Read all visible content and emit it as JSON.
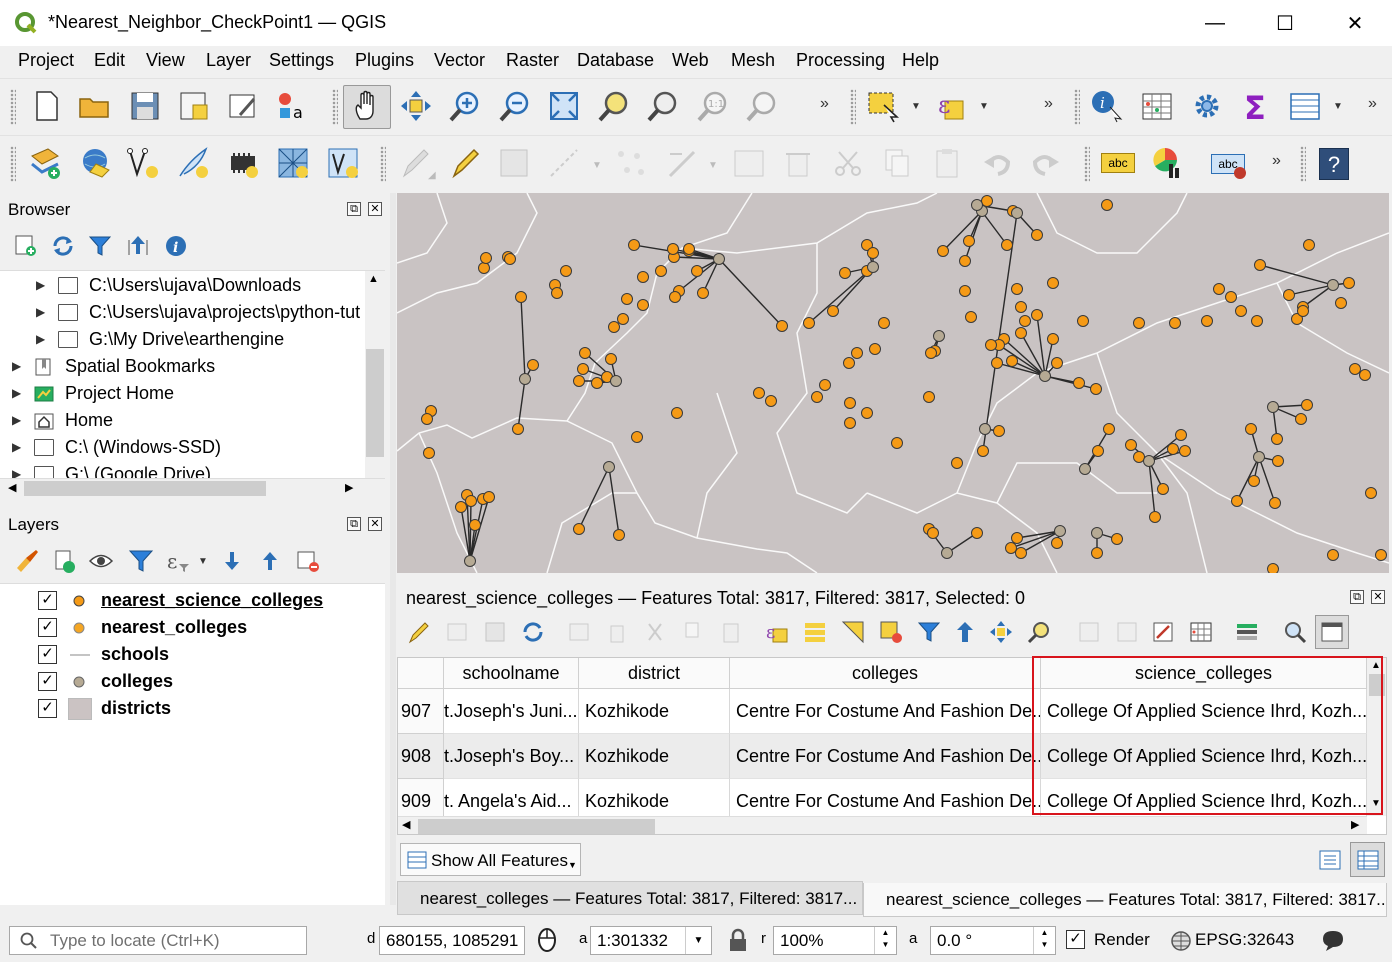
{
  "window": {
    "title": "*Nearest_Neighbor_CheckPoint1 — QGIS",
    "minimize": "—",
    "maximize": "☐",
    "close": "✕"
  },
  "menubar": {
    "items": [
      "Project",
      "Edit",
      "View",
      "Layer",
      "Settings",
      "Plugins",
      "Vector",
      "Raster",
      "Database",
      "Web",
      "Mesh",
      "Processing",
      "Help"
    ]
  },
  "toolbar1": {
    "icons": [
      "new-project-icon",
      "open-project-icon",
      "save-project-icon",
      "new-print-layout-icon",
      "layout-manager-icon",
      "style-manager-icon",
      "pan-hand-icon",
      "pan-to-selection-icon",
      "zoom-in-icon",
      "zoom-out-icon",
      "zoom-full-icon",
      "zoom-to-selection-icon",
      "zoom-to-layer-icon",
      "zoom-native-icon",
      "zoom-last-icon",
      "select-features-icon",
      "select-by-expression-icon",
      "identify-icon",
      "attribute-table-icon",
      "settings-gear-icon",
      "statistics-sum-icon",
      "open-table-icon"
    ],
    "overflow": "»"
  },
  "toolbar2": {
    "icons": [
      "data-source-manager-icon",
      "new-geopackage-icon",
      "new-shapefile-icon",
      "new-temporary-layer-icon",
      "new-virtual-layer-icon",
      "new-mesh-icon",
      "new-spatialite-icon",
      "edits-icon",
      "toggle-editing-icon",
      "save-edits-icon",
      "digitize-icon",
      "vertex-tool-icon",
      "modify-attributes-icon",
      "delete-selected-icon",
      "cut-icon",
      "copy-icon",
      "paste-icon",
      "undo-icon",
      "redo-icon",
      "label-abc-icon",
      "diagram-icon",
      "label-tool-icon",
      "help-icon"
    ],
    "label_abc": "abc",
    "help": "?",
    "overflow": "»"
  },
  "browser": {
    "title": "Browser",
    "items": [
      {
        "label": "C:\\Users\\ujava\\Downloads",
        "indent": 1
      },
      {
        "label": "C:\\Users\\ujava\\projects\\python-tut",
        "indent": 1
      },
      {
        "label": "G:\\My Drive\\earthengine",
        "indent": 1
      },
      {
        "label": "Spatial Bookmarks",
        "indent": 0
      },
      {
        "label": "Project Home",
        "indent": 0
      },
      {
        "label": "Home",
        "indent": 0
      },
      {
        "label": "C:\\ (Windows-SSD)",
        "indent": 0
      },
      {
        "label": "G:\\ (Google Drive)",
        "indent": 0
      }
    ]
  },
  "layers": {
    "title": "Layers",
    "items": [
      {
        "label": "nearest_science_colleges",
        "checked": "✓",
        "active": true
      },
      {
        "label": "nearest_colleges",
        "checked": "✓"
      },
      {
        "label": "schools",
        "checked": "✓"
      },
      {
        "label": "colleges",
        "checked": "✓"
      },
      {
        "label": "districts",
        "checked": "✓"
      }
    ]
  },
  "attribute_table": {
    "title": "nearest_science_colleges — Features Total: 3817, Filtered: 3817, Selected: 0",
    "columns": [
      "schoolname",
      "district",
      "colleges",
      "science_colleges"
    ],
    "rows": [
      {
        "id": "907",
        "schoolname": "t.Joseph's Juni...",
        "district": "Kozhikode",
        "colleges": "Centre For Costume And Fashion De...",
        "science_colleges": "College Of Applied Science Ihrd, Kozh..."
      },
      {
        "id": "908",
        "schoolname": "t.Joseph's Boy...",
        "district": "Kozhikode",
        "colleges": "Centre For Costume And Fashion De...",
        "science_colleges": "College Of Applied Science Ihrd, Kozh..."
      },
      {
        "id": "909",
        "schoolname": "t. Angela's Aid...",
        "district": "Kozhikode",
        "colleges": "Centre For Costume And Fashion De...",
        "science_colleges": "College Of Applied Science Ihrd, Kozh..."
      }
    ],
    "show_all": "Show All Features",
    "tabs": [
      "nearest_colleges — Features Total: 3817, Filtered: 3817...",
      "nearest_science_colleges — Features Total: 3817, Filtered: 3817..."
    ]
  },
  "statusbar": {
    "locate_placeholder": "Type to locate (Ctrl+K)",
    "coordinate": "680155, 1085291",
    "scale": "1:301332",
    "magnifier": "100%",
    "rotation": "0.0 °",
    "render_label": "Render",
    "render_checked": "✓",
    "crs": "EPSG:32643"
  },
  "colors": {
    "map_bg": "#c9c3c3",
    "orange_point": "#f59a16",
    "grey_point": "#b6aa94",
    "highlight": "#d8141c"
  }
}
